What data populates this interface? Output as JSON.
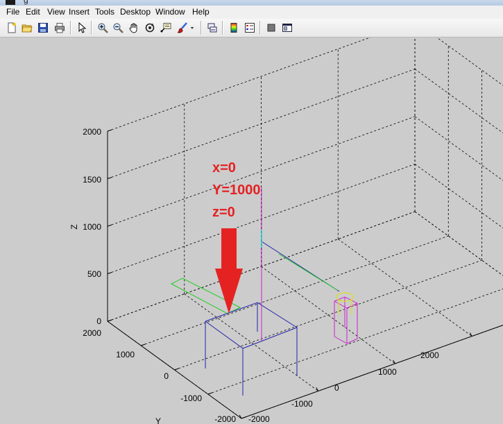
{
  "window": {
    "title": "g"
  },
  "menu": [
    "File",
    "Edit",
    "View",
    "Insert",
    "Tools",
    "Desktop",
    "Window",
    "Help"
  ],
  "toolbar": {
    "buttons": [
      {
        "name": "new-figure-button",
        "icon": "new-document-icon"
      },
      {
        "name": "open-file-button",
        "icon": "folder-open-icon"
      },
      {
        "name": "save-button",
        "icon": "floppy-disk-icon"
      },
      {
        "name": "print-button",
        "icon": "printer-icon"
      },
      {
        "name": "edit-plot-button",
        "icon": "arrow-cursor-icon"
      },
      {
        "name": "zoom-in-button",
        "icon": "zoom-in-icon"
      },
      {
        "name": "zoom-out-button",
        "icon": "zoom-out-icon"
      },
      {
        "name": "pan-button",
        "icon": "hand-icon"
      },
      {
        "name": "rotate-3d-button",
        "icon": "rotate-3d-icon"
      },
      {
        "name": "data-cursor-button",
        "icon": "data-cursor-icon"
      },
      {
        "name": "brush-button",
        "icon": "brush-icon"
      },
      {
        "name": "brush-dropdown-button",
        "icon": "chevron-down-icon"
      },
      {
        "name": "link-plot-button",
        "icon": "link-plot-icon"
      },
      {
        "name": "insert-colorbar-button",
        "icon": "colorbar-icon"
      },
      {
        "name": "insert-legend-button",
        "icon": "legend-icon"
      },
      {
        "name": "hide-plot-tools-button",
        "icon": "hide-tools-icon"
      },
      {
        "name": "show-plot-tools-button",
        "icon": "show-tools-icon"
      }
    ]
  },
  "colors": {
    "background": "#cccccc",
    "annotation": "#e52222",
    "blue": "#2222aa",
    "magenta": "#cc22cc",
    "green": "#22cc22",
    "yellow": "#dddd22",
    "cyan": "#22cccc"
  },
  "annotation": {
    "lines": [
      "x=0",
      "Y=1000",
      "z=0"
    ]
  },
  "chart_data": {
    "type": "3d-line",
    "zlabel": "Z",
    "ylabel": "Y",
    "xlabel": "",
    "z_ticks": [
      "0",
      "500",
      "1000",
      "1500",
      "2000"
    ],
    "y_ticks": [
      "2000",
      "1000",
      "0",
      "-1000",
      "-2000"
    ],
    "x_ticks": [
      "-2000",
      "-1000",
      "0",
      "1000",
      "2000"
    ],
    "xlim": [
      -2000,
      2000
    ],
    "ylim": [
      -2000,
      2000
    ],
    "zlim": [
      0,
      2000
    ],
    "grid": true,
    "box": true
  }
}
